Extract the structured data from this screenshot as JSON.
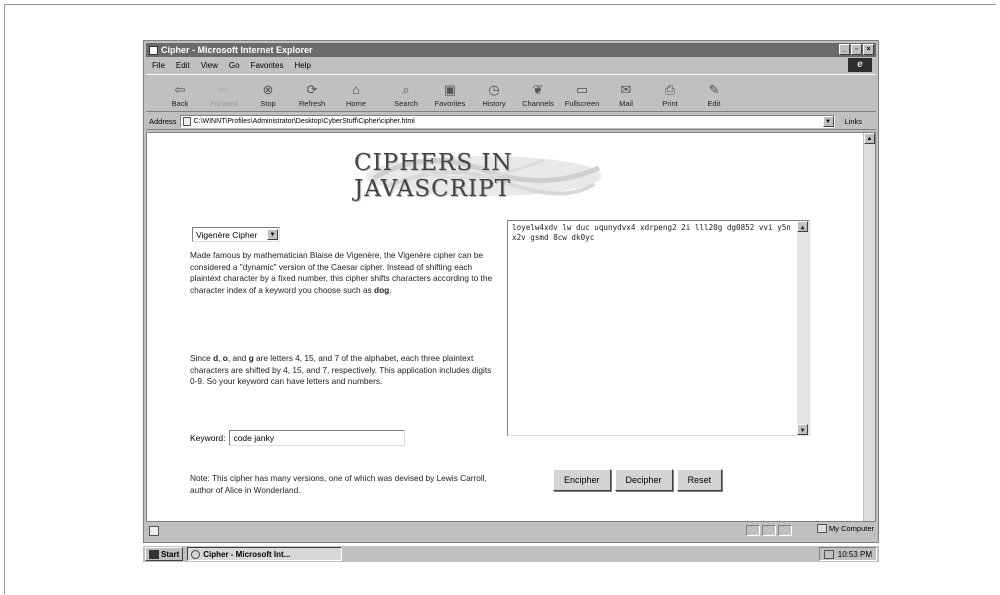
{
  "window": {
    "title": "Cipher - Microsoft Internet Explorer",
    "controls": [
      "_",
      "▫",
      "×"
    ]
  },
  "menu": [
    "File",
    "Edit",
    "View",
    "Go",
    "Favorites",
    "Help"
  ],
  "toolbar": [
    {
      "label": "Back",
      "icon": "back-arrow-icon",
      "glyph": "⇦"
    },
    {
      "label": "Forward",
      "icon": "forward-arrow-icon",
      "glyph": "⇨"
    },
    {
      "label": "Stop",
      "icon": "stop-icon",
      "glyph": "⊗"
    },
    {
      "label": "Refresh",
      "icon": "refresh-icon",
      "glyph": "⟳"
    },
    {
      "label": "Home",
      "icon": "home-icon",
      "glyph": "⌂"
    },
    {
      "label": "Search",
      "icon": "search-icon",
      "glyph": "⌕"
    },
    {
      "label": "Favorites",
      "icon": "favorites-icon",
      "glyph": "▣"
    },
    {
      "label": "History",
      "icon": "history-icon",
      "glyph": "◷"
    },
    {
      "label": "Channels",
      "icon": "channels-icon",
      "glyph": "❦"
    },
    {
      "label": "Fullscreen",
      "icon": "fullscreen-icon",
      "glyph": "▭"
    },
    {
      "label": "Mail",
      "icon": "mail-icon",
      "glyph": "✉"
    },
    {
      "label": "Print",
      "icon": "print-icon",
      "glyph": "⎙"
    },
    {
      "label": "Edit",
      "icon": "edit-icon",
      "glyph": "✎"
    }
  ],
  "address": {
    "label": "Address",
    "url": "C:\\WINNT\\Profiles\\Administrator\\Desktop\\CyberStuff\\Cipher\\cipher.html",
    "links_label": "Links"
  },
  "page": {
    "banner_title": "CIPHERS IN JAVASCRIPT",
    "cipher_select": "Vigenère Cipher",
    "paragraph1_parts": [
      "Made famous by mathematician Blaise de Vigenère, the Vigenère cipher can be considered a \"dynamic\" version of the Caesar cipher. Instead of shifting each plaintext character by a fixed number, this cipher shifts characters according to the character index of a keyword you choose such as ",
      "dog",
      "."
    ],
    "paragraph2_parts": [
      "Since ",
      "d",
      ", ",
      "o",
      ", and ",
      "g",
      " are letters 4, 15, and 7 of the alphabet, each three plaintext characters are shifted by 4, 15, and 7, respectively. This application includes digits 0-9. So your keyword can have letters and numbers."
    ],
    "keyword_label": "Keyword:",
    "keyword_value": "code janky",
    "output_text": "loyelw4xdv lw duc uqunydvx4 xdrpeng2 2i lll20g dg0852 vvi y5nx2v gsmd 8cw dk0yc",
    "buttons": [
      "Encipher",
      "Decipher",
      "Reset"
    ],
    "note": "Note: This cipher has many versions, one of which was devised by Lewis Carroll, author of Alice in Wonderland."
  },
  "status": {
    "zone": "My Computer"
  },
  "taskbar": {
    "start": "Start",
    "task": "Cipher - Microsoft Int...",
    "time": "10:53 PM"
  }
}
